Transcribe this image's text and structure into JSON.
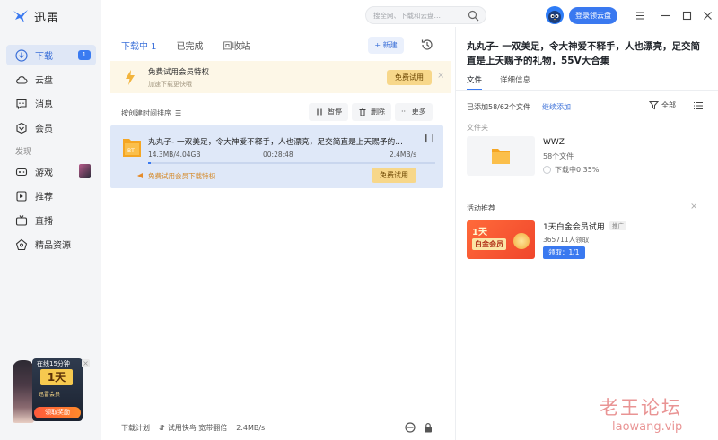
{
  "app": {
    "name": "迅雷"
  },
  "sidebar": {
    "items": [
      {
        "label": "下载",
        "badge": "1",
        "icon": "download-icon",
        "active": true
      },
      {
        "label": "云盘",
        "icon": "cloud-icon"
      },
      {
        "label": "消息",
        "icon": "message-icon"
      },
      {
        "label": "会员",
        "icon": "member-icon"
      }
    ],
    "discover_label": "发现",
    "discover_items": [
      {
        "label": "游戏",
        "icon": "game-icon"
      },
      {
        "label": "推荐",
        "icon": "recommend-icon"
      },
      {
        "label": "直播",
        "icon": "live-icon"
      },
      {
        "label": "精品资源",
        "icon": "resource-icon"
      }
    ],
    "promo": {
      "tag": "在线15分钟",
      "day": "1天",
      "sub": "迅雷会员",
      "button": "领取奖励"
    }
  },
  "topbar": {
    "search_placeholder": "搜全网、下载和云盘…",
    "login_button": "登录领云盘"
  },
  "download": {
    "tabs": [
      "下载中 1",
      "已完成",
      "回收站"
    ],
    "new_button": "+ 新建",
    "vip_banner": {
      "title": "免费试用会员特权",
      "subtitle": "加速下载更快哦",
      "button": "免费试用"
    },
    "sort_label": "按创建时间排序",
    "toolbar": {
      "pause": "暂停",
      "delete": "删除",
      "more": "更多"
    },
    "task": {
      "name": "丸丸子- 一双美足，令大神爱不释手，人也漂亮，足交简直是上天赐予的…",
      "file_type": "BT",
      "size": "14.3MB/4.04GB",
      "time": "00:28:48",
      "speed": "2.4MB/s",
      "progress": 0.0035,
      "vip_text": "免费试用会员下载特权",
      "vip_button": "免费试用"
    },
    "footer": {
      "plan": "下载计划",
      "boost": "试用快鸟 宽带翻倍",
      "speed": "2.4MB/s"
    }
  },
  "detail": {
    "title": "丸丸子- 一双美足，令大神爱不释手，人也漂亮，足交简直是上天赐予的礼物，55V大合集",
    "tabs": [
      "文件",
      "详细信息"
    ],
    "added": "已添加58/62个文件",
    "continue_link": "继续添加",
    "filter": "全部",
    "folder_label": "文件夹",
    "folder": {
      "name": "WWZ",
      "count": "58个文件",
      "status": "下载中0.35%"
    },
    "activity": {
      "label": "活动推荐",
      "image_big": "1天",
      "image_sub": "白金会员",
      "title": "1天白金会员试用",
      "ad": "推广",
      "count": "365711人领取",
      "claim": "领取：1/1"
    }
  },
  "watermark": {
    "line1": "老王论坛",
    "line2": "laowang.vip"
  },
  "colors": {
    "accent": "#3a79f0",
    "sidebar_bg": "#f4f5f7",
    "vip_gold": "#f7d78a"
  }
}
